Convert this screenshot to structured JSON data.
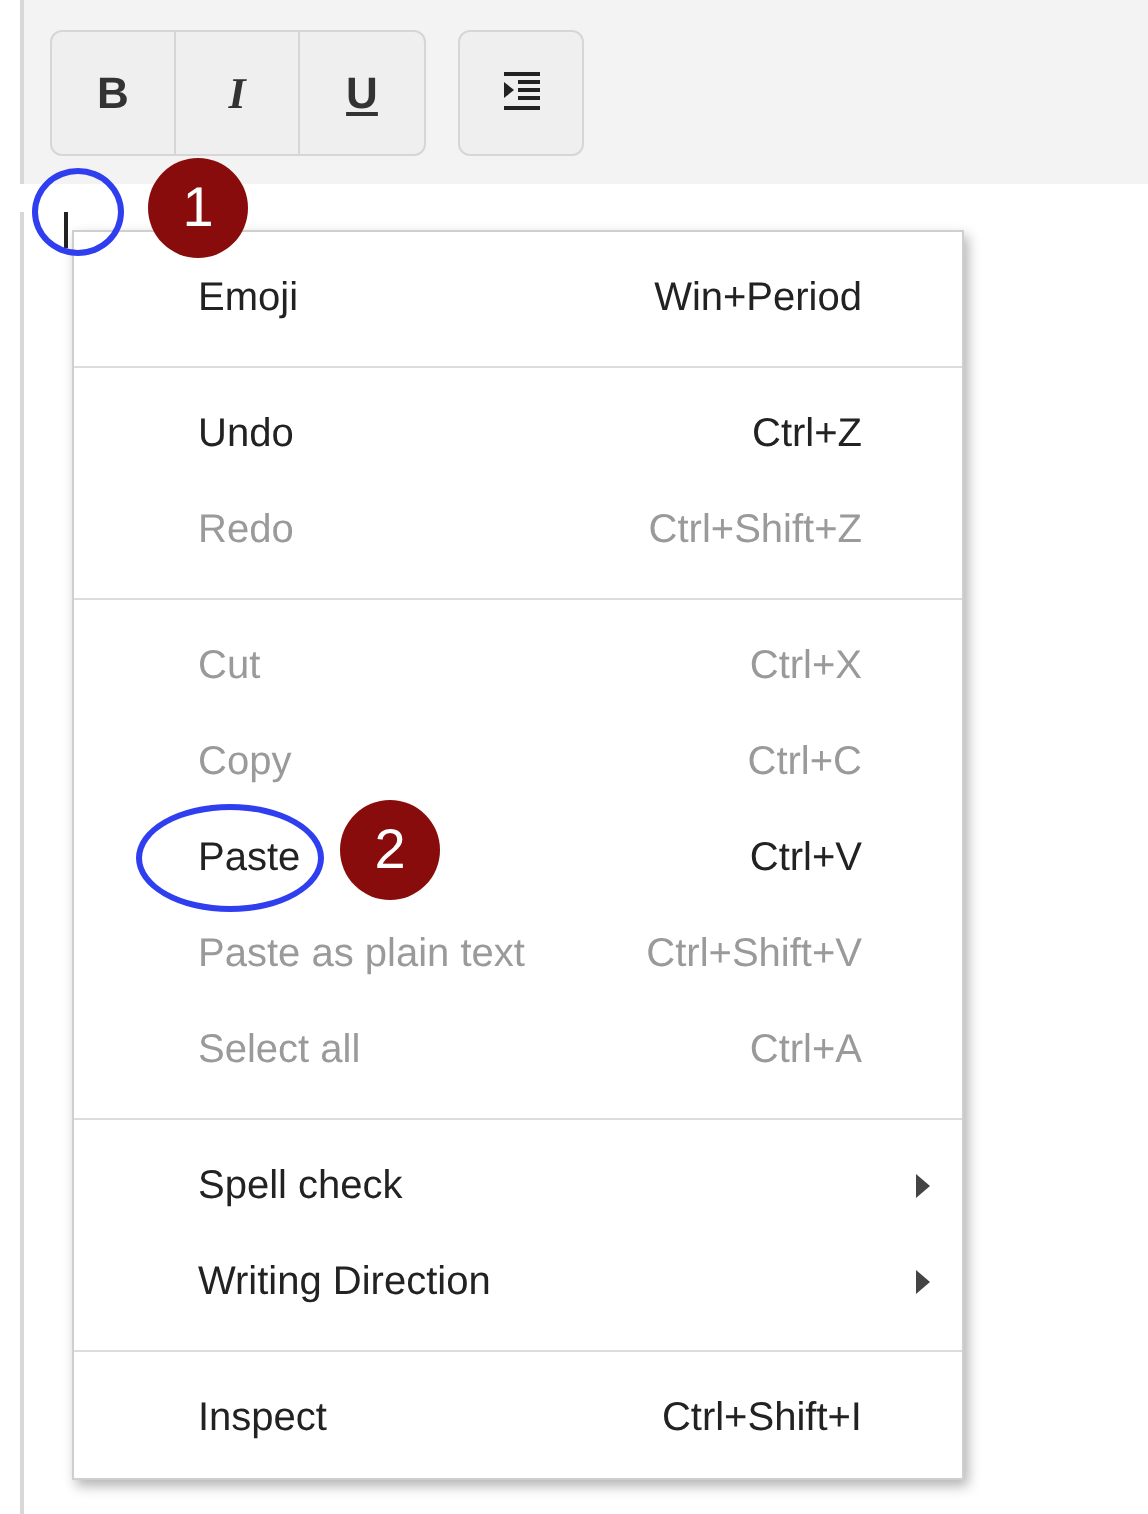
{
  "toolbar": {
    "format_buttons": [
      {
        "label": "B",
        "kind": "bold"
      },
      {
        "label": "I",
        "kind": "italic"
      },
      {
        "label": "U",
        "kind": "underline"
      }
    ]
  },
  "context_menu": {
    "items": [
      {
        "kind": "item",
        "label": "Emoji",
        "shortcut": "Win+Period",
        "disabled": false,
        "submenu": false
      },
      {
        "kind": "separator"
      },
      {
        "kind": "item",
        "label": "Undo",
        "shortcut": "Ctrl+Z",
        "disabled": false,
        "submenu": false
      },
      {
        "kind": "item",
        "label": "Redo",
        "shortcut": "Ctrl+Shift+Z",
        "disabled": true,
        "submenu": false
      },
      {
        "kind": "separator"
      },
      {
        "kind": "item",
        "label": "Cut",
        "shortcut": "Ctrl+X",
        "disabled": true,
        "submenu": false
      },
      {
        "kind": "item",
        "label": "Copy",
        "shortcut": "Ctrl+C",
        "disabled": true,
        "submenu": false
      },
      {
        "kind": "item",
        "label": "Paste",
        "shortcut": "Ctrl+V",
        "disabled": false,
        "submenu": false
      },
      {
        "kind": "item",
        "label": "Paste as plain text",
        "shortcut": "Ctrl+Shift+V",
        "disabled": true,
        "submenu": false
      },
      {
        "kind": "item",
        "label": "Select all",
        "shortcut": "Ctrl+A",
        "disabled": true,
        "submenu": false
      },
      {
        "kind": "separator"
      },
      {
        "kind": "item",
        "label": "Spell check",
        "disabled": false,
        "submenu": true
      },
      {
        "kind": "item",
        "label": "Writing Direction",
        "disabled": false,
        "submenu": true
      },
      {
        "kind": "separator"
      },
      {
        "kind": "item",
        "label": "Inspect",
        "shortcut": "Ctrl+Shift+I",
        "disabled": false,
        "submenu": false
      }
    ]
  },
  "callouts": [
    {
      "number": "1"
    },
    {
      "number": "2"
    }
  ]
}
